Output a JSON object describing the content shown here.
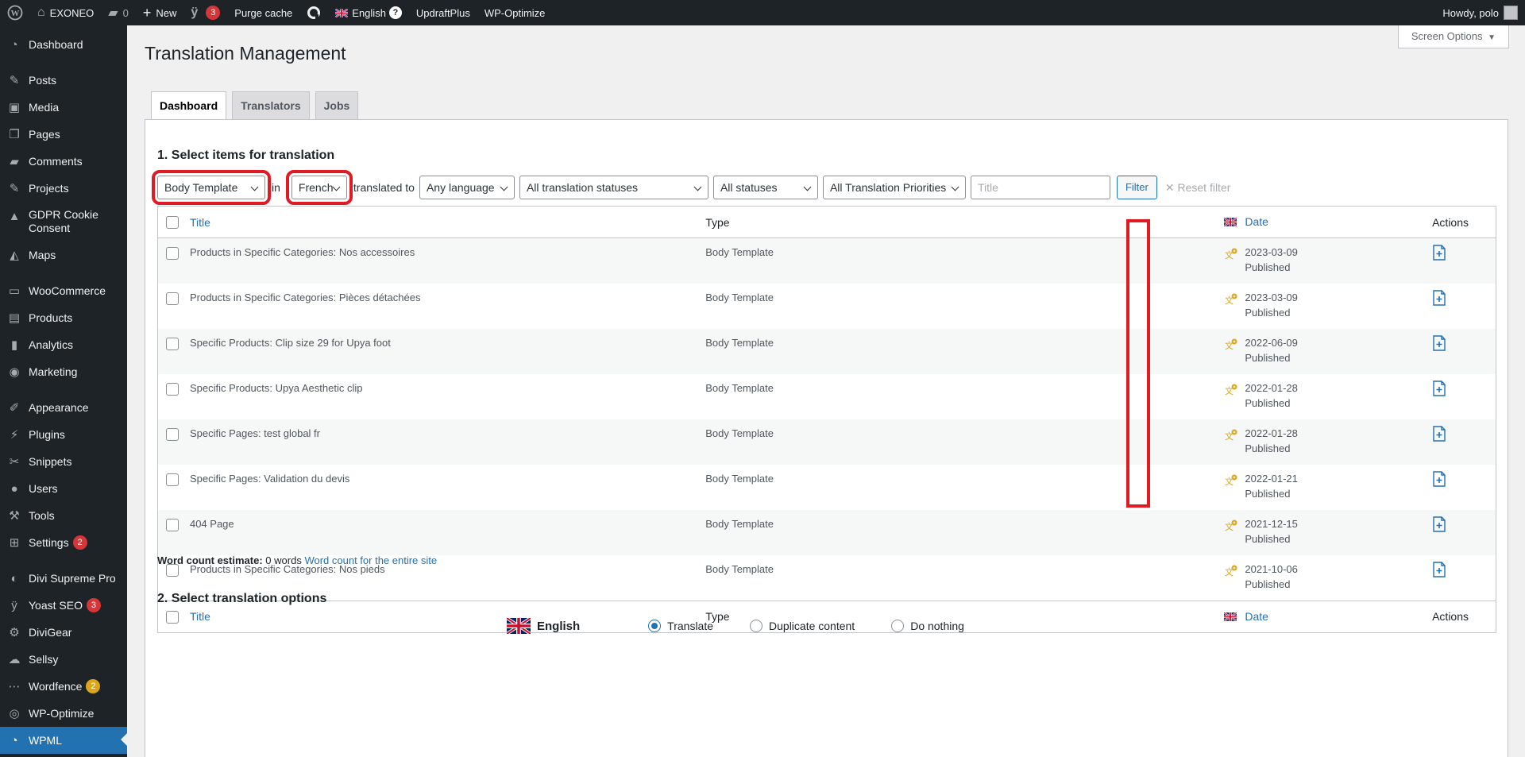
{
  "adminbar": {
    "site_name": "EXONEO",
    "comments_count": "0",
    "new_label": "New",
    "yoast_badge": "3",
    "purge_cache": "Purge cache",
    "language": "English",
    "language_badge": "?",
    "updraft": "UpdraftPlus",
    "wpoptimize": "WP-Optimize",
    "howdy": "Howdy, polo"
  },
  "sidebar": {
    "items": [
      {
        "label": "Dashboard",
        "icon": "dashboard-icon"
      },
      {
        "label": "Posts",
        "icon": "pin-icon"
      },
      {
        "label": "Media",
        "icon": "media-icon"
      },
      {
        "label": "Pages",
        "icon": "pages-icon"
      },
      {
        "label": "Comments",
        "icon": "comment-icon"
      },
      {
        "label": "Projects",
        "icon": "pin-icon"
      },
      {
        "label": "GDPR Cookie Consent",
        "icon": "lock-icon"
      },
      {
        "label": "Maps",
        "icon": "map-icon"
      },
      {
        "label": "WooCommerce",
        "icon": "woo-icon"
      },
      {
        "label": "Products",
        "icon": "archive-icon"
      },
      {
        "label": "Analytics",
        "icon": "bar-chart-icon"
      },
      {
        "label": "Marketing",
        "icon": "megaphone-icon"
      },
      {
        "label": "Appearance",
        "icon": "brush-icon"
      },
      {
        "label": "Plugins",
        "icon": "plugin-icon"
      },
      {
        "label": "Snippets",
        "icon": "scissors-icon"
      },
      {
        "label": "Users",
        "icon": "user-icon"
      },
      {
        "label": "Tools",
        "icon": "wrench-icon"
      },
      {
        "label": "Settings",
        "icon": "settings-icon",
        "badge": "2"
      },
      {
        "label": "Divi Supreme Pro",
        "icon": "divi-icon"
      },
      {
        "label": "Yoast SEO",
        "icon": "yoast-icon",
        "badge": "3"
      },
      {
        "label": "DiviGear",
        "icon": "gear-icon"
      },
      {
        "label": "Sellsy",
        "icon": "cloud-icon"
      },
      {
        "label": "Wordfence",
        "icon": "wordfence-icon",
        "badge": "2"
      },
      {
        "label": "WP-Optimize",
        "icon": "optimize-icon"
      },
      {
        "label": "WPML",
        "icon": "wpml-icon"
      }
    ]
  },
  "screen_options": "Screen Options",
  "page_title": "Translation Management",
  "tabs": [
    "Dashboard",
    "Translators",
    "Jobs"
  ],
  "section1_title": "1. Select items for translation",
  "filters": {
    "type": "Body Template",
    "in_label": "in",
    "source_lang": "French",
    "translated_to_label": "translated to",
    "target_lang": "Any language",
    "translation_status": "All translation statuses",
    "status": "All statuses",
    "priority": "All Translation Priorities",
    "title_placeholder": "Title",
    "filter_button": "Filter",
    "reset_filter": "Reset filter"
  },
  "table": {
    "headers": {
      "title": "Title",
      "type": "Type",
      "date": "Date",
      "actions": "Actions"
    },
    "rows": [
      {
        "title": "Products in Specific Categories: Nos accessoires",
        "type": "Body Template",
        "date": "2023-03-09",
        "status": "Published"
      },
      {
        "title": "Products in Specific Categories: Pièces détachées",
        "type": "Body Template",
        "date": "2023-03-09",
        "status": "Published"
      },
      {
        "title": "Specific Products: Clip size 29 for Upya foot",
        "type": "Body Template",
        "date": "2022-06-09",
        "status": "Published"
      },
      {
        "title": "Specific Products: Upya Aesthetic clip",
        "type": "Body Template",
        "date": "2022-01-28",
        "status": "Published"
      },
      {
        "title": "Specific Pages: test global fr",
        "type": "Body Template",
        "date": "2022-01-28",
        "status": "Published"
      },
      {
        "title": "Specific Pages: Validation du devis",
        "type": "Body Template",
        "date": "2022-01-21",
        "status": "Published"
      },
      {
        "title": "404 Page",
        "type": "Body Template",
        "date": "2021-12-15",
        "status": "Published"
      },
      {
        "title": "Products in Specific Categories: Nos pieds",
        "type": "Body Template",
        "date": "2021-10-06",
        "status": "Published"
      }
    ]
  },
  "word_count": {
    "label": "Word count estimate:",
    "value": "0 words",
    "link": "Word count for the entire site"
  },
  "section2_title": "2. Select translation options",
  "options": {
    "language": "English",
    "translate": "Translate",
    "duplicate": "Duplicate content",
    "nothing": "Do nothing"
  },
  "colors": {
    "accent": "#2271b1",
    "highlight": "#e01b24",
    "status_icon": "#dba617"
  }
}
